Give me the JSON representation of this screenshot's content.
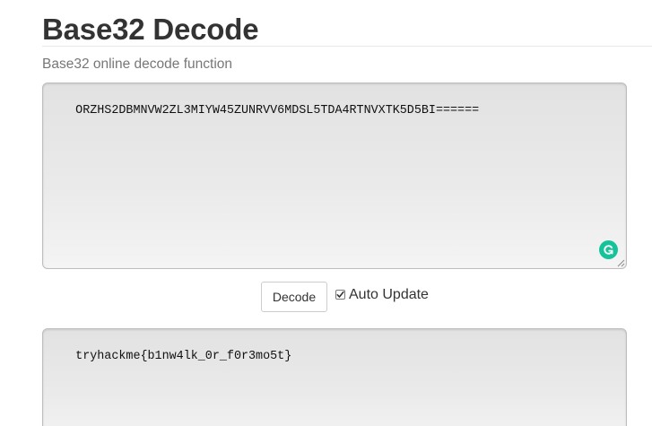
{
  "page": {
    "title": "Base32 Decode",
    "subtitle": "Base32 online decode function"
  },
  "input": {
    "value": "ORZHS2DBMNVW2ZL3MIYW45ZUNRVV6MDSL5TDA4RTNVXTK5D5BI======"
  },
  "controls": {
    "decode_label": "Decode",
    "auto_update_label": "Auto Update",
    "auto_update_checked": true
  },
  "output": {
    "value": "tryhackme{b1nw4lk_0r_f0r3mo5t}"
  },
  "icons": {
    "grammarly": "grammarly-icon",
    "checkmark": "checkmark-icon",
    "resize": "resize-grip-icon"
  },
  "colors": {
    "grammarly_green": "#15c39a",
    "heading": "#333333",
    "subtitle": "#777777"
  }
}
